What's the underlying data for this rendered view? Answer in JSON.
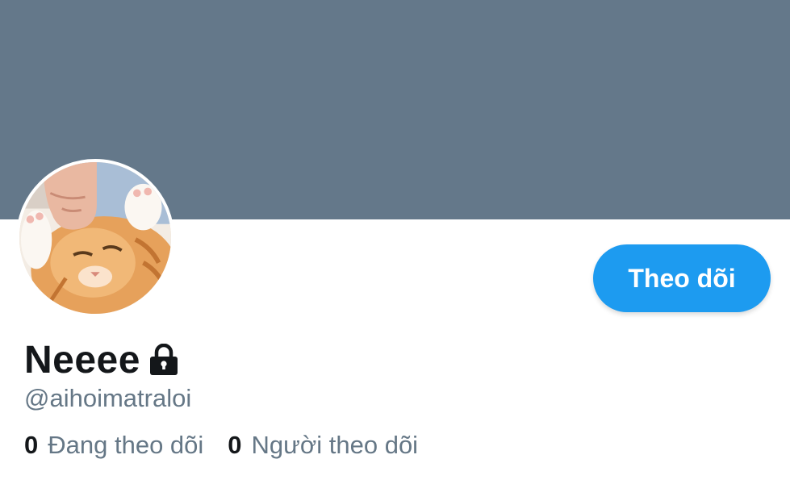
{
  "profile": {
    "display_name": "Neeee",
    "handle": "@aihoimatraloi",
    "follow_label": "Theo dõi",
    "stats": {
      "following_count": "0",
      "following_label": "Đang theo dõi",
      "followers_count": "0",
      "followers_label": "Người theo dõi"
    },
    "icons": {
      "lock": "lock-icon",
      "avatar": "cat-photo"
    }
  },
  "colors": {
    "banner": "#64788a",
    "accent": "#1d9bf0",
    "text_primary": "#14171a",
    "text_secondary": "#657786"
  }
}
